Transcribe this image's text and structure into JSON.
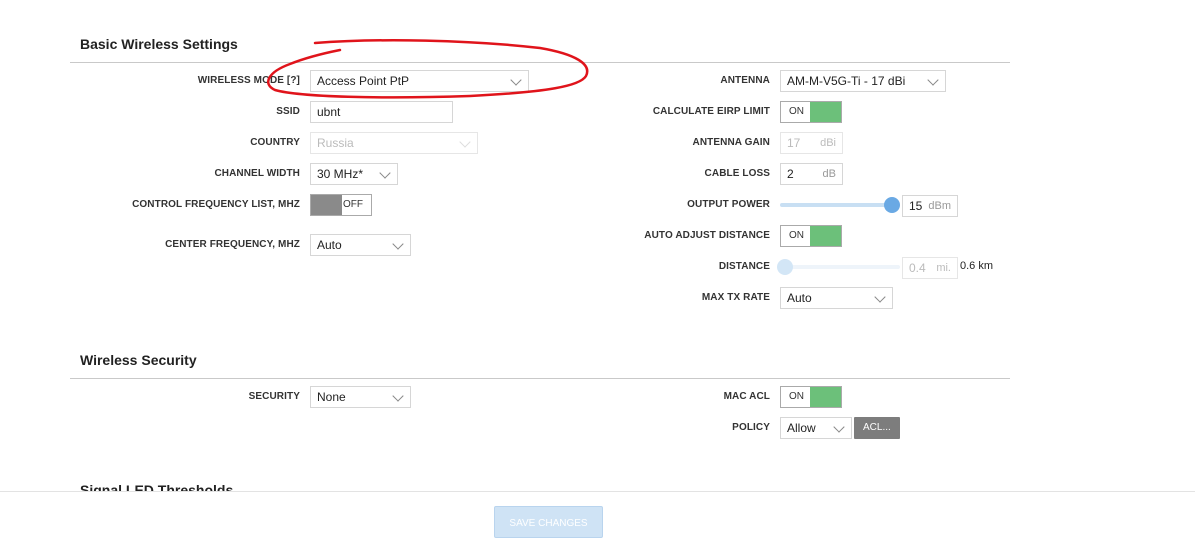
{
  "basic": {
    "title": "Basic Wireless Settings",
    "wireless_mode": {
      "label": "WIRELESS MODE [?]",
      "value": "Access Point PtP"
    },
    "ssid": {
      "label": "SSID",
      "value": "ubnt"
    },
    "country": {
      "label": "COUNTRY",
      "value": "Russia"
    },
    "channel_width": {
      "label": "CHANNEL WIDTH",
      "value": "30 MHz*"
    },
    "control_freq": {
      "label": "CONTROL FREQUENCY LIST, MHZ",
      "state": "OFF"
    },
    "center_freq": {
      "label": "CENTER FREQUENCY, MHZ",
      "value": "Auto"
    },
    "antenna": {
      "label": "ANTENNA",
      "value": "AM-M-V5G-Ti - 17 dBi"
    },
    "eirp": {
      "label": "CALCULATE EIRP LIMIT",
      "state": "ON"
    },
    "antenna_gain": {
      "label": "ANTENNA GAIN",
      "value": "17",
      "unit": "dBi"
    },
    "cable_loss": {
      "label": "CABLE LOSS",
      "value": "2",
      "unit": "dB"
    },
    "output_power": {
      "label": "OUTPUT POWER",
      "value": "15",
      "unit": "dBm",
      "level": 1.0
    },
    "auto_distance": {
      "label": "AUTO ADJUST DISTANCE",
      "state": "ON"
    },
    "distance": {
      "label": "DISTANCE",
      "value": "0.4",
      "unit": "mi.",
      "km": "0.6 km",
      "level": 0.0
    },
    "max_tx_rate": {
      "label": "MAX TX RATE",
      "value": "Auto"
    }
  },
  "security": {
    "title": "Wireless Security",
    "security": {
      "label": "SECURITY",
      "value": "None"
    },
    "mac_acl": {
      "label": "MAC ACL",
      "state": "ON"
    },
    "policy": {
      "label": "POLICY",
      "value": "Allow",
      "acl_button": "ACL..."
    }
  },
  "signal": {
    "title": "Signal LED Thresholds"
  },
  "footer": {
    "save_label": "SAVE CHANGES"
  },
  "colors": {
    "toggle_on": "#6cc07a",
    "toggle_off": "#8a8a8a",
    "slider": "#6aa9e4",
    "annotation": "#e0141b"
  }
}
